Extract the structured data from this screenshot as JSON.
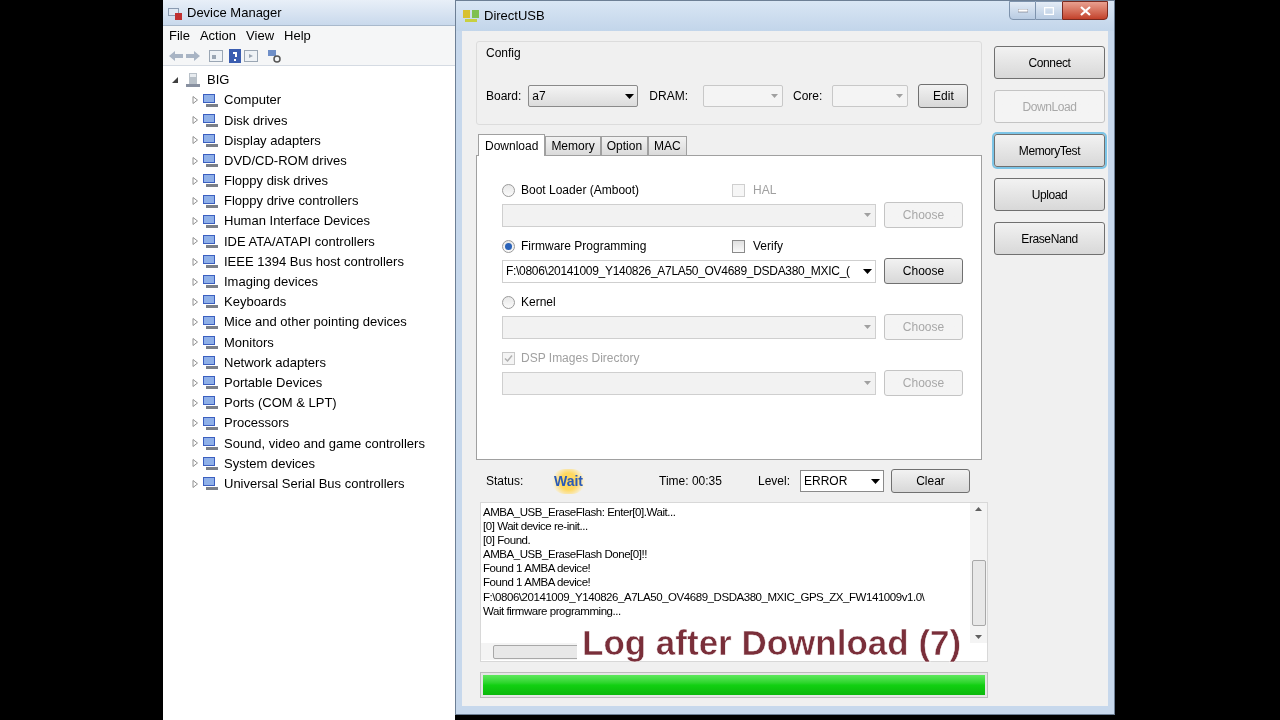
{
  "device_manager": {
    "title": "Device Manager",
    "menu": [
      "File",
      "Action",
      "View",
      "Help"
    ],
    "tree": {
      "label": "BIG",
      "expanded": true,
      "children": [
        {
          "label": "Computer",
          "expanded": false
        },
        {
          "label": "Disk drives",
          "expanded": false
        },
        {
          "label": "Display adapters",
          "expanded": false
        },
        {
          "label": "DVD/CD-ROM drives",
          "expanded": false
        },
        {
          "label": "Floppy disk drives",
          "expanded": false
        },
        {
          "label": "Floppy drive controllers",
          "expanded": false
        },
        {
          "label": "Human Interface Devices",
          "expanded": false
        },
        {
          "label": "IDE ATA/ATAPI controllers",
          "expanded": false
        },
        {
          "label": "IEEE 1394 Bus host controllers",
          "expanded": false
        },
        {
          "label": "Imaging devices",
          "expanded": false
        },
        {
          "label": "Keyboards",
          "expanded": false
        },
        {
          "label": "Mice and other pointing devices",
          "expanded": false
        },
        {
          "label": "Monitors",
          "expanded": false
        },
        {
          "label": "Network adapters",
          "expanded": false
        },
        {
          "label": "Portable Devices",
          "expanded": false
        },
        {
          "label": "Ports (COM & LPT)",
          "expanded": false
        },
        {
          "label": "Processors",
          "expanded": false
        },
        {
          "label": "Sound, video and game controllers",
          "expanded": false
        },
        {
          "label": "System devices",
          "expanded": false
        },
        {
          "label": "Universal Serial Bus controllers",
          "expanded": false
        }
      ]
    }
  },
  "direct_usb": {
    "title": "DirectUSB",
    "config": {
      "title": "Config",
      "board": {
        "label": "Board:",
        "value": "a7",
        "disabled": false
      },
      "dram": {
        "label": "DRAM:",
        "disabled": true
      },
      "core": {
        "label": "Core:",
        "disabled": true
      },
      "edit": "Edit"
    },
    "tabs": [
      {
        "label": "Download",
        "selected": true
      },
      {
        "label": "Memory",
        "selected": false
      },
      {
        "label": "Option",
        "selected": false
      },
      {
        "label": "MAC",
        "selected": false
      }
    ],
    "options": [
      {
        "kind": "radio",
        "label": "Boot Loader (Amboot)",
        "selected": false,
        "disabled": false,
        "side_check": {
          "label": "HAL",
          "checked": false,
          "disabled": true
        },
        "field": {
          "disabled": true
        },
        "choose": {
          "label": "Choose",
          "disabled": true
        }
      },
      {
        "kind": "radio",
        "label": "Firmware Programming",
        "selected": true,
        "disabled": false,
        "side_check": {
          "label": "Verify",
          "checked": false,
          "disabled": false
        },
        "field": {
          "value": "F:\\0806\\20141009_Y140826_A7LA50_OV4689_DSDA380_MXIC_(",
          "disabled": false
        },
        "choose": {
          "label": "Choose",
          "disabled": false
        }
      },
      {
        "kind": "radio",
        "label": "Kernel",
        "selected": false,
        "disabled": false,
        "field": {
          "disabled": true
        },
        "choose": {
          "label": "Choose",
          "disabled": true
        }
      },
      {
        "kind": "checkbox",
        "label": "DSP Images Directory",
        "checked": true,
        "disabled": true,
        "field": {
          "disabled": true
        },
        "choose": {
          "label": "Choose",
          "disabled": true
        }
      }
    ],
    "status": {
      "label": "Status:",
      "value": "Wait",
      "time": "Time: 00:35",
      "level_label": "Level:",
      "level_value": "ERROR",
      "clear": "Clear"
    },
    "log": [
      "AMBA_USB_EraseFlash: Enter[0].Wait...",
      "[0] Wait device re-init...",
      "[0] Found.",
      "AMBA_USB_EraseFlash Done[0]!!",
      "Found 1 AMBA device!",
      "Found 1 AMBA device!",
      "F:\\0806\\20141009_Y140826_A7LA50_OV4689_DSDA380_MXIC_GPS_ZX_FW141009v1.0\\",
      "Wait firmware programming..."
    ],
    "progress": {
      "level": 1
    },
    "buttons": [
      {
        "label": "Connect",
        "disabled": false,
        "focused": false
      },
      {
        "label": "DownLoad",
        "disabled": true,
        "focused": false
      },
      {
        "label": "MemoryTest",
        "disabled": false,
        "focused": true
      },
      {
        "label": "Upload",
        "disabled": false,
        "focused": false
      },
      {
        "label": "EraseNand",
        "disabled": false,
        "focused": false
      }
    ]
  },
  "caption": "Log after Download (7)"
}
